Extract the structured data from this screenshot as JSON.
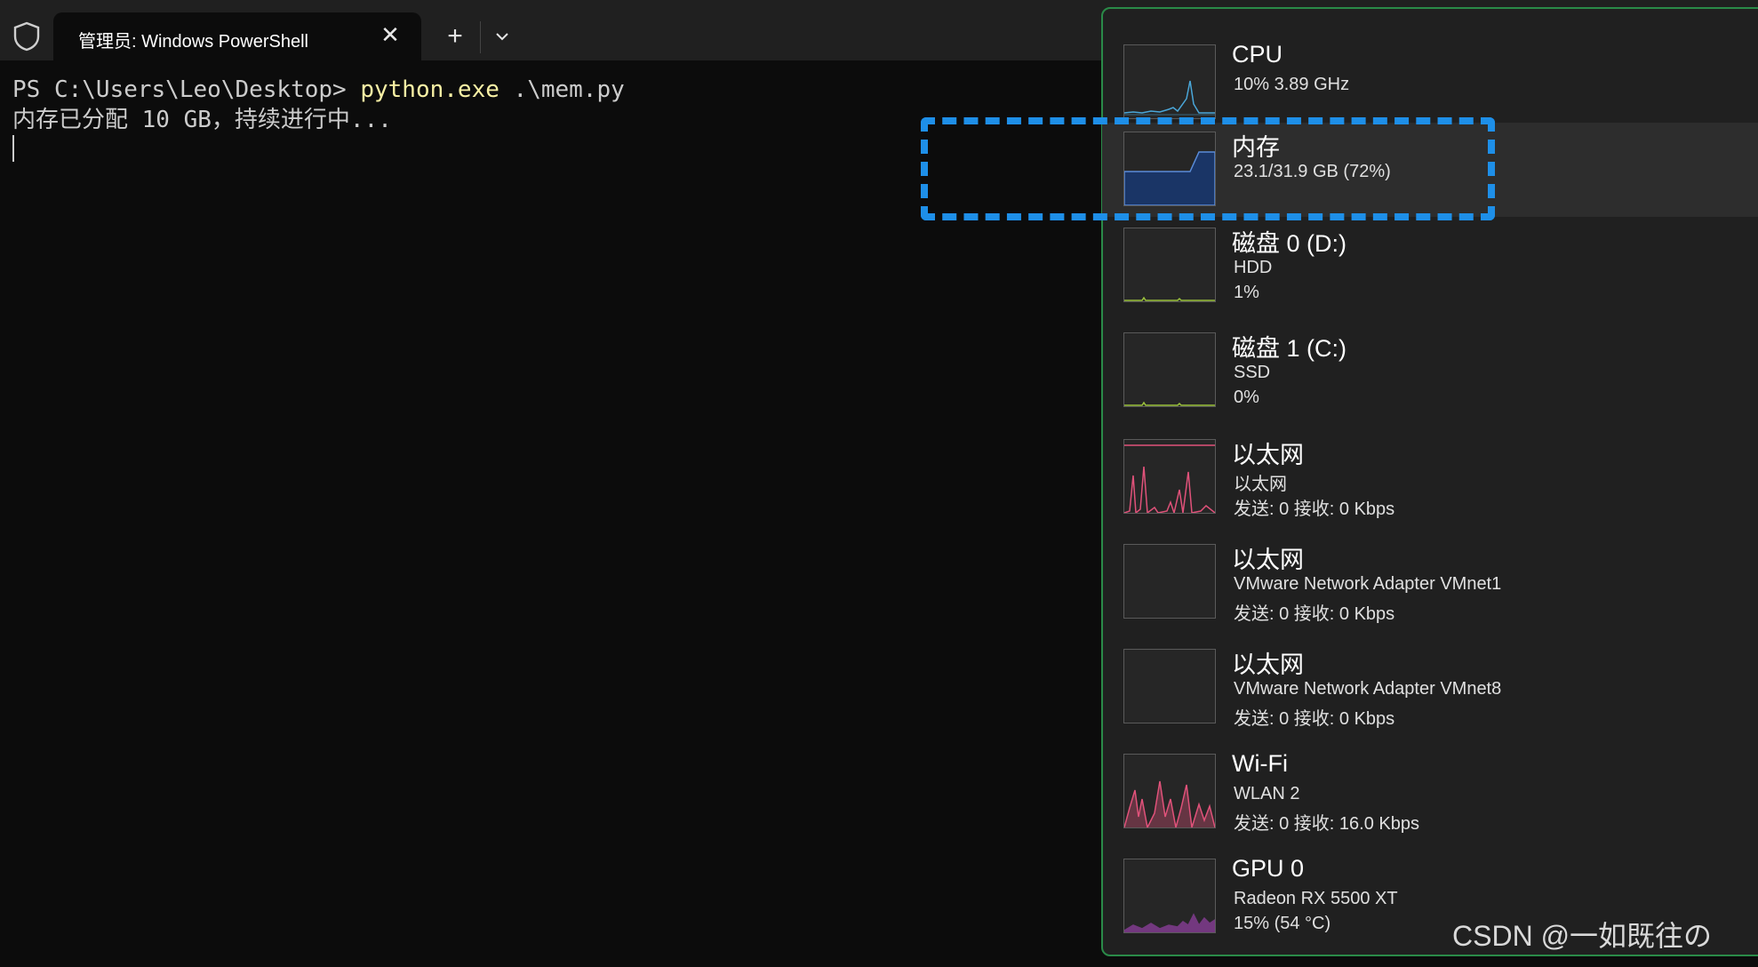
{
  "terminal": {
    "tab_title": "管理员: Windows PowerShell",
    "close_glyph": "✕",
    "newtab_glyph": "+",
    "prompt": "PS C:\\Users\\Leo\\Desktop> ",
    "command": "python.exe",
    "args": " .\\mem.py",
    "output": "内存已分配 10 GB，持续进行中..."
  },
  "task_manager": {
    "items": [
      {
        "title": "CPU",
        "line1": "10%  3.89 GHz",
        "line2": "",
        "color": "#4aa6d8"
      },
      {
        "title": "内存",
        "line1": "23.1/31.9 GB (72%)",
        "line2": "",
        "color": "#5a8cd8",
        "selected": true
      },
      {
        "title": "磁盘 0 (D:)",
        "line1": "HDD",
        "line2": "1%",
        "color": "#9bc23c"
      },
      {
        "title": "磁盘 1 (C:)",
        "line1": "SSD",
        "line2": "0%",
        "color": "#9bc23c"
      },
      {
        "title": "以太网",
        "line1": "以太网",
        "line2": "发送: 0  接收: 0 Kbps",
        "color": "#e0527a"
      },
      {
        "title": "以太网",
        "line1": "VMware Network Adapter VMnet1",
        "line2": "发送: 0  接收: 0 Kbps",
        "color": "#e0527a"
      },
      {
        "title": "以太网",
        "line1": "VMware Network Adapter VMnet8",
        "line2": "发送: 0  接收: 0 Kbps",
        "color": "#e0527a"
      },
      {
        "title": "Wi-Fi",
        "line1": "WLAN 2",
        "line2": "发送: 0  接收: 16.0 Kbps",
        "color": "#e0527a"
      },
      {
        "title": "GPU 0",
        "line1": "Radeon RX 5500 XT",
        "line2": "15%  (54 °C)",
        "color": "#c04ad8"
      }
    ]
  },
  "watermark": "CSDN @一如既往の",
  "colors": {
    "highlight": "#1e8fe8",
    "panel_border": "#2a8a48",
    "command": "#f9f1a5"
  }
}
